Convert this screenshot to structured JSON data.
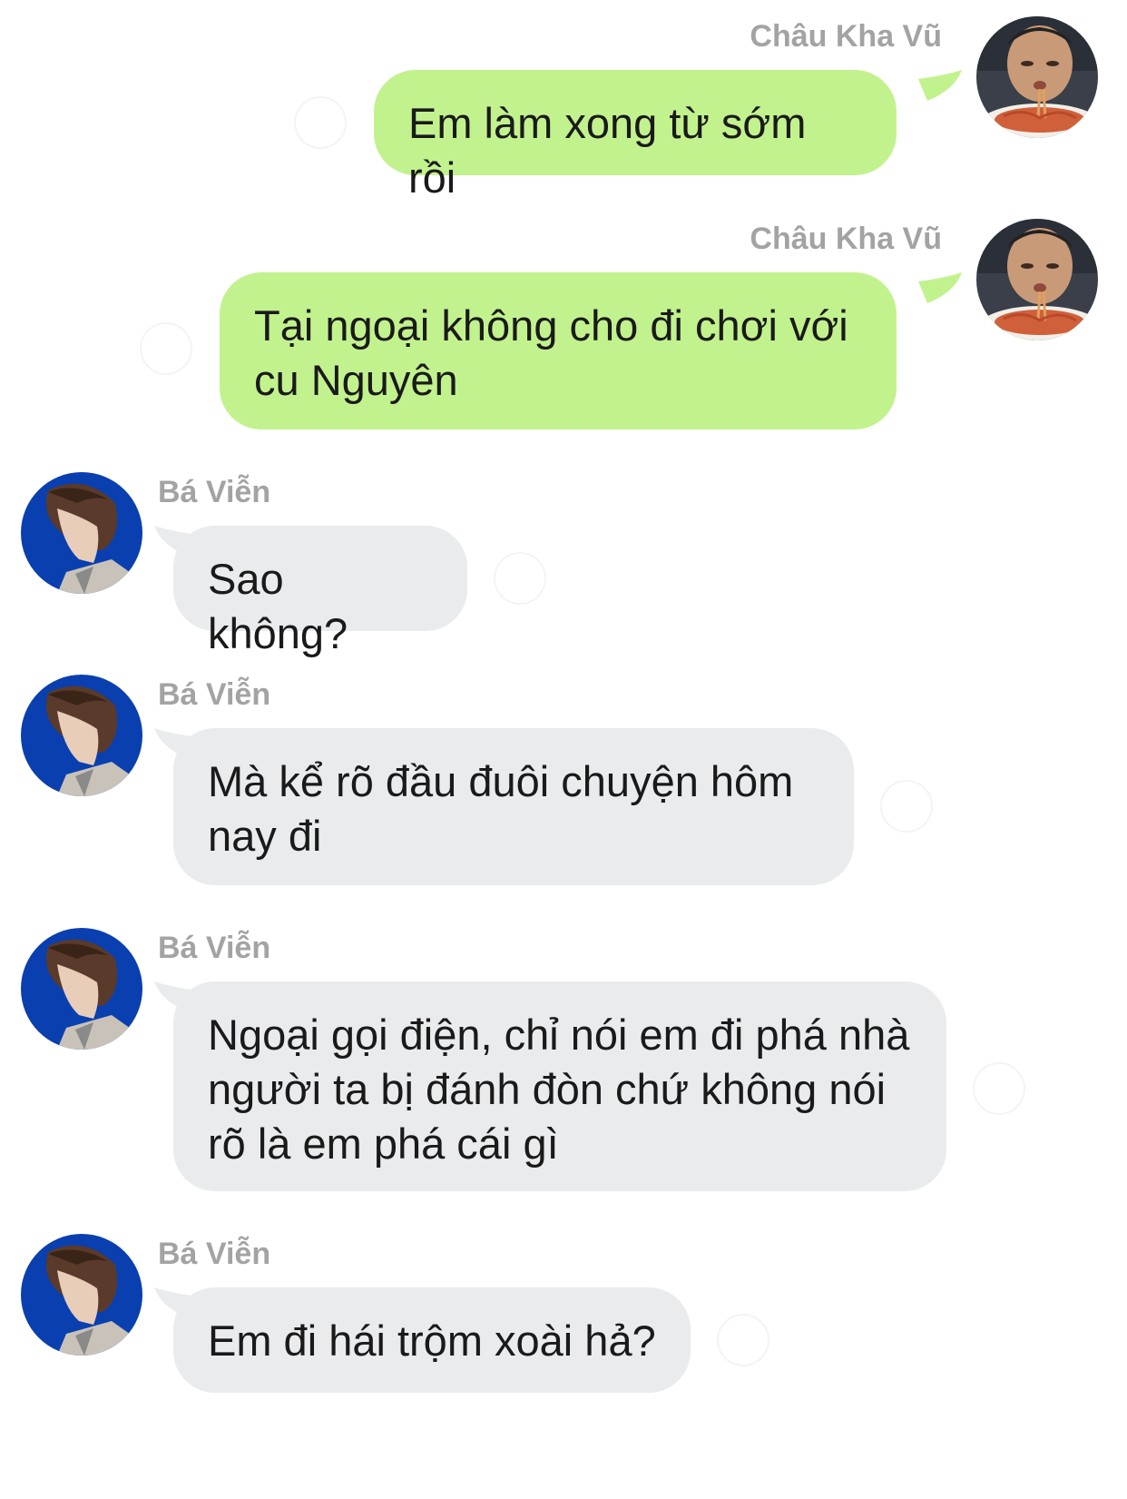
{
  "colors": {
    "outgoing_bubble": "#c2f28d",
    "incoming_bubble": "#eaebed",
    "sender_name": "#a3a3a3",
    "text": "#1a1a1a",
    "incoming_avatar_bg": "#0a3fb0"
  },
  "messages": [
    {
      "sender": "Châu Kha Vũ",
      "direction": "outgoing",
      "avatar": "boy-eating-spaghetti-avatar",
      "text": "Em làm xong từ sớm rồi"
    },
    {
      "sender": "Châu Kha Vũ",
      "direction": "outgoing",
      "avatar": "boy-eating-spaghetti-avatar",
      "text": "Tại ngoại không cho đi chơi với cu Nguyên"
    },
    {
      "sender": "Bá Viễn",
      "direction": "incoming",
      "avatar": "profile-portrait-blue-avatar",
      "text": "Sao không?"
    },
    {
      "sender": "Bá Viễn",
      "direction": "incoming",
      "avatar": "profile-portrait-blue-avatar",
      "text": "Mà kể rõ đầu đuôi chuyện hôm nay đi"
    },
    {
      "sender": "Bá Viễn",
      "direction": "incoming",
      "avatar": "profile-portrait-blue-avatar",
      "text": "Ngoại gọi điện, chỉ nói em đi phá nhà người ta bị đánh đòn chứ không nói rõ là em phá cái gì"
    },
    {
      "sender": "Bá Viễn",
      "direction": "incoming",
      "avatar": "profile-portrait-blue-avatar",
      "text": "Em đi hái trộm xoài hả?"
    }
  ]
}
